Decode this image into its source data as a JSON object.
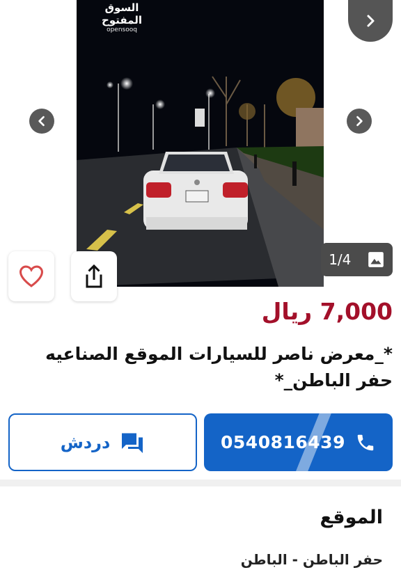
{
  "gallery": {
    "watermark_ar": "السوق المفتوح",
    "watermark_en": "opensooq",
    "counter": "1/4",
    "icons": {
      "next_top": "chevron-right-icon",
      "prev": "chevron-left-icon",
      "next": "chevron-right-icon",
      "photos": "image-icon"
    }
  },
  "actions": {
    "favorite_icon": "heart-icon",
    "share_icon": "share-icon"
  },
  "listing": {
    "price": "7,000 ريال",
    "title": "*_معرض ناصر للسيارات الموقع الصناعيه حفر الباطن_*"
  },
  "contact": {
    "phone": "0540816439",
    "phone_icon": "phone-icon",
    "chat_label": "دردش",
    "chat_icon": "chat-icon"
  },
  "location": {
    "heading": "الموقع",
    "value": "حفر الباطن - الباطن"
  },
  "colors": {
    "price": "#a3102a",
    "primary": "#1464c7"
  }
}
